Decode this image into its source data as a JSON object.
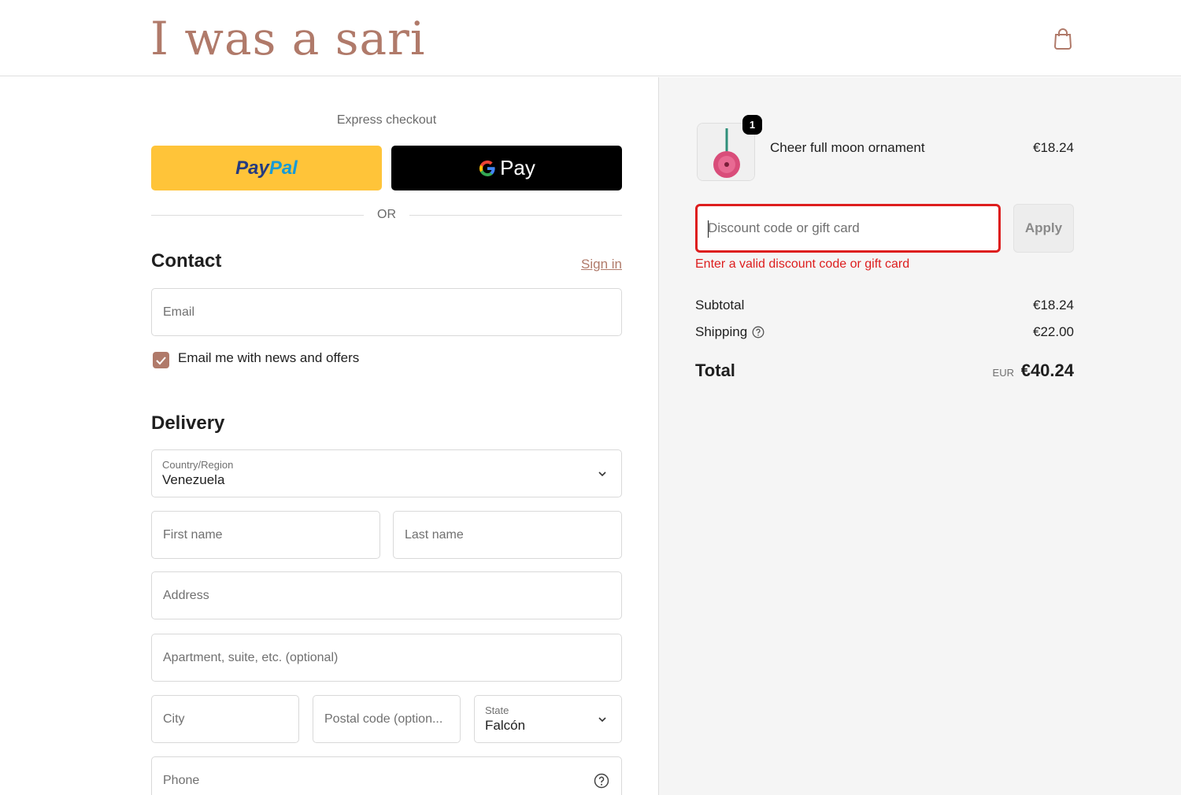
{
  "header": {
    "logo": "I was a sari",
    "cart_icon": "shopping-bag-icon"
  },
  "express": {
    "label": "Express checkout",
    "paypal_part1": "Pay",
    "paypal_part2": "Pal",
    "gpay_label": "Pay",
    "or": "OR"
  },
  "contact": {
    "title": "Contact",
    "sign_in": "Sign in",
    "email_placeholder": "Email",
    "newsletter_checked": true,
    "newsletter_label": "Email me with news and offers"
  },
  "delivery": {
    "title": "Delivery",
    "country_label": "Country/Region",
    "country_value": "Venezuela",
    "first_name_placeholder": "First name",
    "last_name_placeholder": "Last name",
    "address_placeholder": "Address",
    "apartment_placeholder": "Apartment, suite, etc. (optional)",
    "city_placeholder": "City",
    "postal_placeholder": "Postal code (option...",
    "state_label": "State",
    "state_value": "Falcón",
    "phone_placeholder": "Phone"
  },
  "summary": {
    "item": {
      "quantity": "1",
      "name": "Cheer full moon ornament",
      "price": "€18.24"
    },
    "discount_placeholder": "Discount code or gift card",
    "apply_label": "Apply",
    "discount_error": "Enter a valid discount code or gift card",
    "subtotal_label": "Subtotal",
    "subtotal_value": "€18.24",
    "shipping_label": "Shipping",
    "shipping_value": "€22.00",
    "total_label": "Total",
    "total_currency": "EUR",
    "total_value": "€40.24"
  },
  "colors": {
    "brand": "#b07a6a",
    "error": "#dd1d1d",
    "paypal": "#ffc439"
  }
}
